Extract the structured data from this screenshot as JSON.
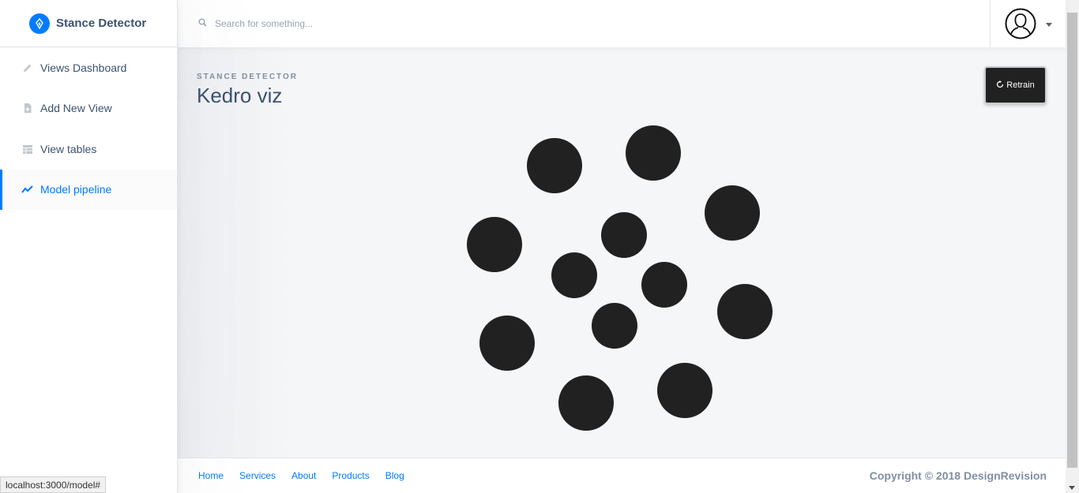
{
  "brand": {
    "name": "Stance Detector"
  },
  "sidebar": {
    "items": [
      {
        "label": "Views Dashboard",
        "icon": "pencil-icon",
        "active": false
      },
      {
        "label": "Add New View",
        "icon": "note-add-icon",
        "active": false
      },
      {
        "label": "View tables",
        "icon": "table-icon",
        "active": false
      },
      {
        "label": "Model pipeline",
        "icon": "chart-line-icon",
        "active": true
      }
    ]
  },
  "header": {
    "search_placeholder": "Search for something...",
    "user_icon": "user-avatar-icon"
  },
  "page": {
    "subtitle": "Stance Detector",
    "title": "Kedro viz",
    "retrain_label": "Retrain",
    "loader_icon": "spinner-dots-icon"
  },
  "footer": {
    "links": [
      "Home",
      "Services",
      "About",
      "Products",
      "Blog"
    ],
    "copyright": "Copyright © 2018 DesignRevision"
  },
  "status": {
    "url": "localhost:3000/model#"
  },
  "colors": {
    "accent": "#007bff",
    "dark": "#212121",
    "text": "#3d5170",
    "muted": "#818ea3"
  }
}
